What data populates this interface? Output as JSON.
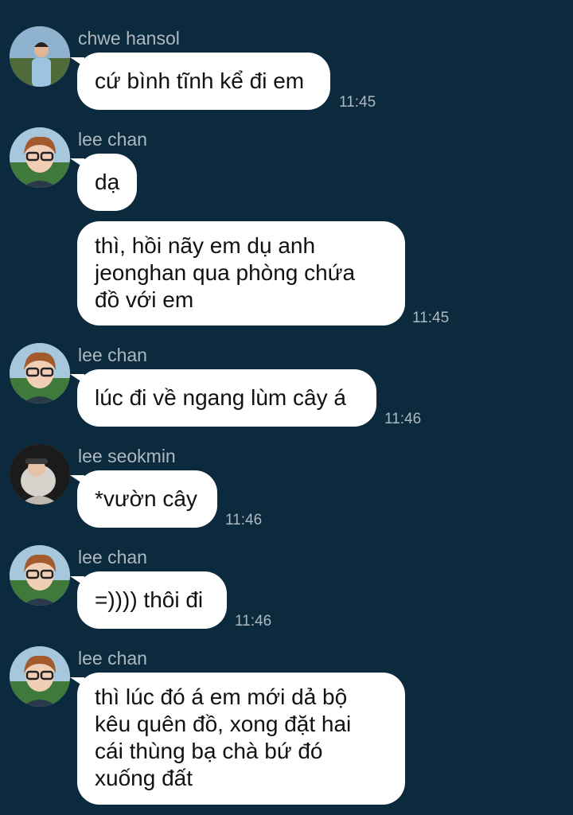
{
  "messages": [
    {
      "sender": "chwe hansol",
      "avatar": "chwe-hansol-avatar",
      "text": "cứ bình tĩnh kể đi em",
      "time": "11:45"
    },
    {
      "sender": "lee chan",
      "avatar": "lee-chan-avatar",
      "text": "dạ",
      "time": ""
    },
    {
      "sender": "",
      "avatar": "",
      "text": "thì, hồi nãy em dụ anh\njeonghan qua phòng chứa\nđồ với em",
      "time": "11:45"
    },
    {
      "sender": "lee chan",
      "avatar": "lee-chan-avatar",
      "text": "lúc đi về ngang lùm cây á",
      "time": "11:46"
    },
    {
      "sender": "lee seokmin",
      "avatar": "lee-seokmin-avatar",
      "text": "*vườn cây",
      "time": "11:46"
    },
    {
      "sender": "lee chan",
      "avatar": "lee-chan-avatar",
      "text": "=)))) thôi đi",
      "time": "11:46"
    },
    {
      "sender": "lee chan",
      "avatar": "lee-chan-avatar",
      "text": "thì lúc đó á em mới dả bộ\nkêu quên đồ, xong đặt hai\ncái thùng bạ chà bứ đó\nxuống đất",
      "time": ""
    }
  ],
  "colors": {
    "background": "#0c2a3d",
    "bubble": "#ffffff",
    "meta_text": "#aeb8bf"
  }
}
